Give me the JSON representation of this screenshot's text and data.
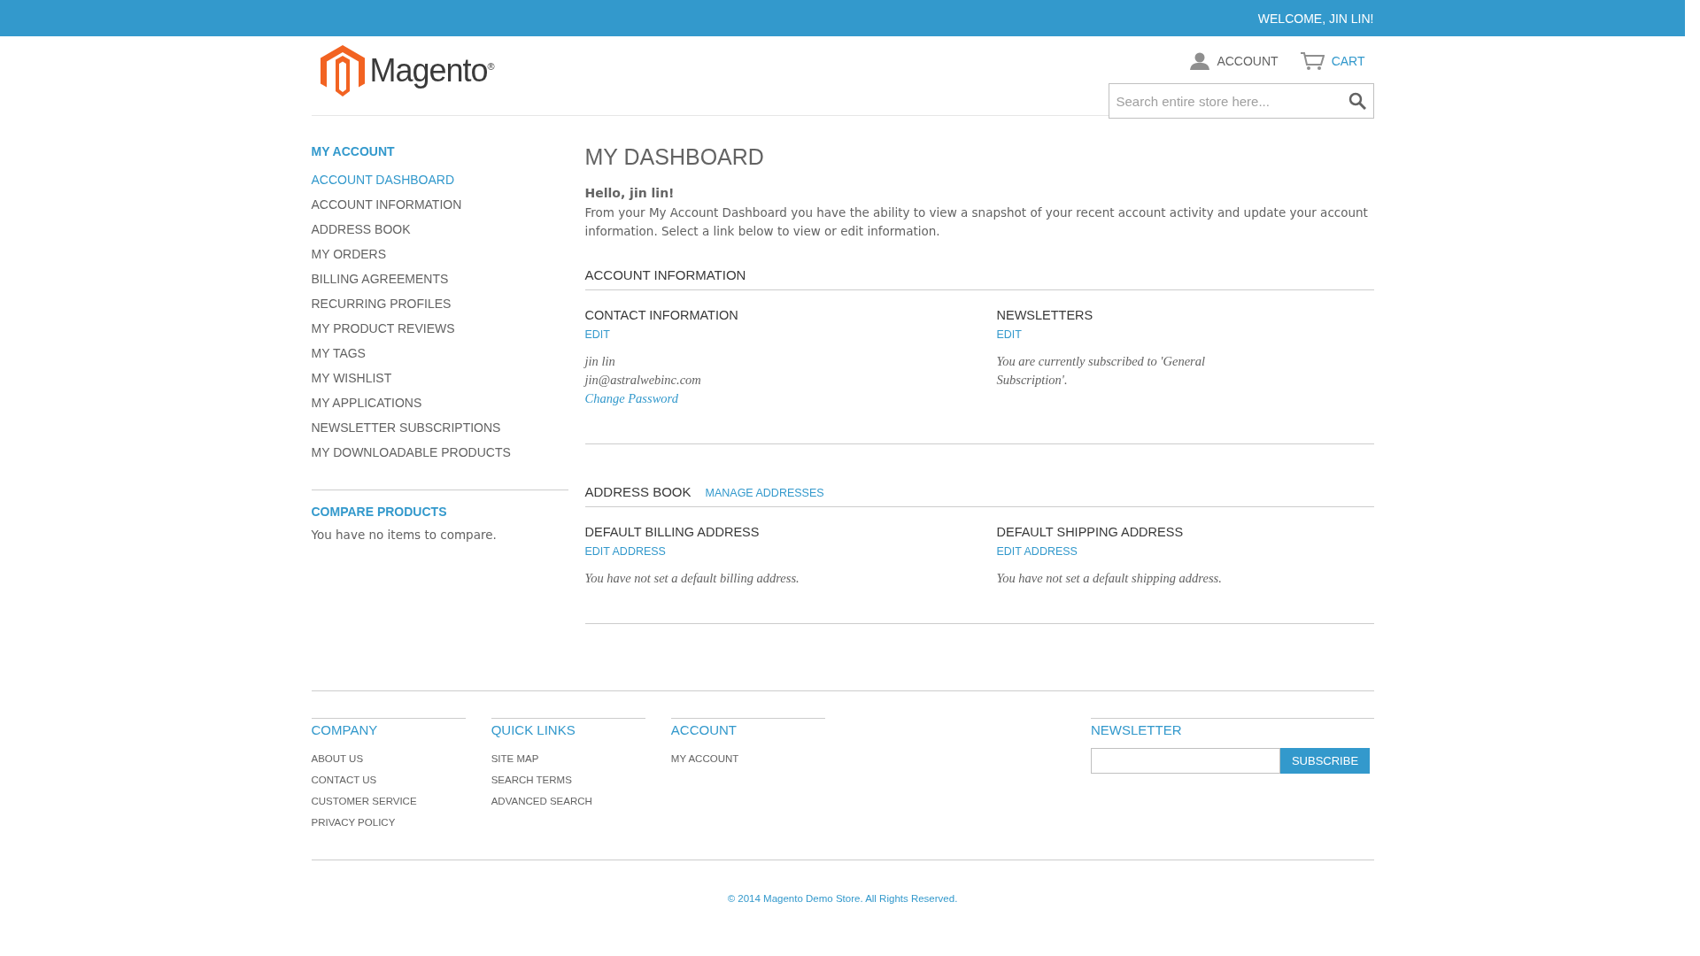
{
  "top_bar": {
    "welcome": "WELCOME, JIN LIN!"
  },
  "header": {
    "logo_text": "Magento$^{®}$",
    "links": [
      {
        "kind": "account",
        "label": "ACCOUNT"
      },
      {
        "kind": "cart",
        "label": "CART"
      }
    ],
    "search": {
      "placeholder": "Search entire store here..."
    }
  },
  "sidebar": {
    "title": "MY ACCOUNT",
    "items": [
      {
        "label": "ACCOUNT DASHBOARD",
        "selected": true
      },
      {
        "label": "ACCOUNT INFORMATION",
        "selected": false
      },
      {
        "label": "ADDRESS BOOK",
        "selected": false
      },
      {
        "label": "MY ORDERS",
        "selected": false
      },
      {
        "label": "BILLING AGREEMENTS",
        "selected": false
      },
      {
        "label": "RECURRING PROFILES",
        "selected": false
      },
      {
        "label": "MY PRODUCT REVIEWS",
        "selected": false
      },
      {
        "label": "MY TAGS",
        "selected": false
      },
      {
        "label": "MY WISHLIST",
        "selected": false
      },
      {
        "label": "MY APPLICATIONS",
        "selected": false
      },
      {
        "label": "NEWSLETTER SUBSCRIPTIONS",
        "selected": false
      },
      {
        "label": "MY DOWNLOADABLE PRODUCTS",
        "selected": false
      }
    ],
    "compare": {
      "title": "COMPARE PRODUCTS",
      "text": "You have no items to compare."
    }
  },
  "main": {
    "title": "MY DASHBOARD",
    "greeting": "Hello, jin lin!",
    "intro": "From your My Account Dashboard you have the ability to view a snapshot of your recent account activity and update your account information. Select a link below to view or edit information.",
    "account_information": {
      "title": "ACCOUNT INFORMATION",
      "boxes": [
        {
          "title": "CONTACT INFORMATION",
          "action": "EDIT",
          "lines": [
            "jin lin",
            "jin@astralwebinc.com"
          ],
          "link": "Change Password"
        },
        {
          "title": "NEWSLETTERS",
          "action": "EDIT",
          "lines": [
            "You are currently subscribed to 'General Subscription'."
          ]
        }
      ]
    },
    "address_book": {
      "title": "ADDRESS BOOK",
      "action": "MANAGE ADDRESSES",
      "boxes": [
        {
          "title": "DEFAULT BILLING ADDRESS",
          "action": "EDIT ADDRESS",
          "lines": [
            "You have not set a default billing address."
          ]
        },
        {
          "title": "DEFAULT SHIPPING ADDRESS",
          "action": "EDIT ADDRESS",
          "lines": [
            "You have not set a default shipping address."
          ]
        }
      ]
    }
  },
  "footer": {
    "columns": [
      {
        "title": "COMPANY",
        "links": [
          "ABOUT US",
          "CONTACT US",
          "CUSTOMER SERVICE",
          "PRIVACY POLICY"
        ]
      },
      {
        "title": "QUICK LINKS",
        "links": [
          "SITE MAP",
          "SEARCH TERMS",
          "ADVANCED SEARCH"
        ]
      },
      {
        "title": "ACCOUNT",
        "links": [
          "MY ACCOUNT"
        ]
      }
    ],
    "newsletter": {
      "title": "NEWSLETTER",
      "button": "SUBSCRIBE"
    },
    "copyright": "© 2014 Magento Demo Store. All Rights Reserved."
  }
}
